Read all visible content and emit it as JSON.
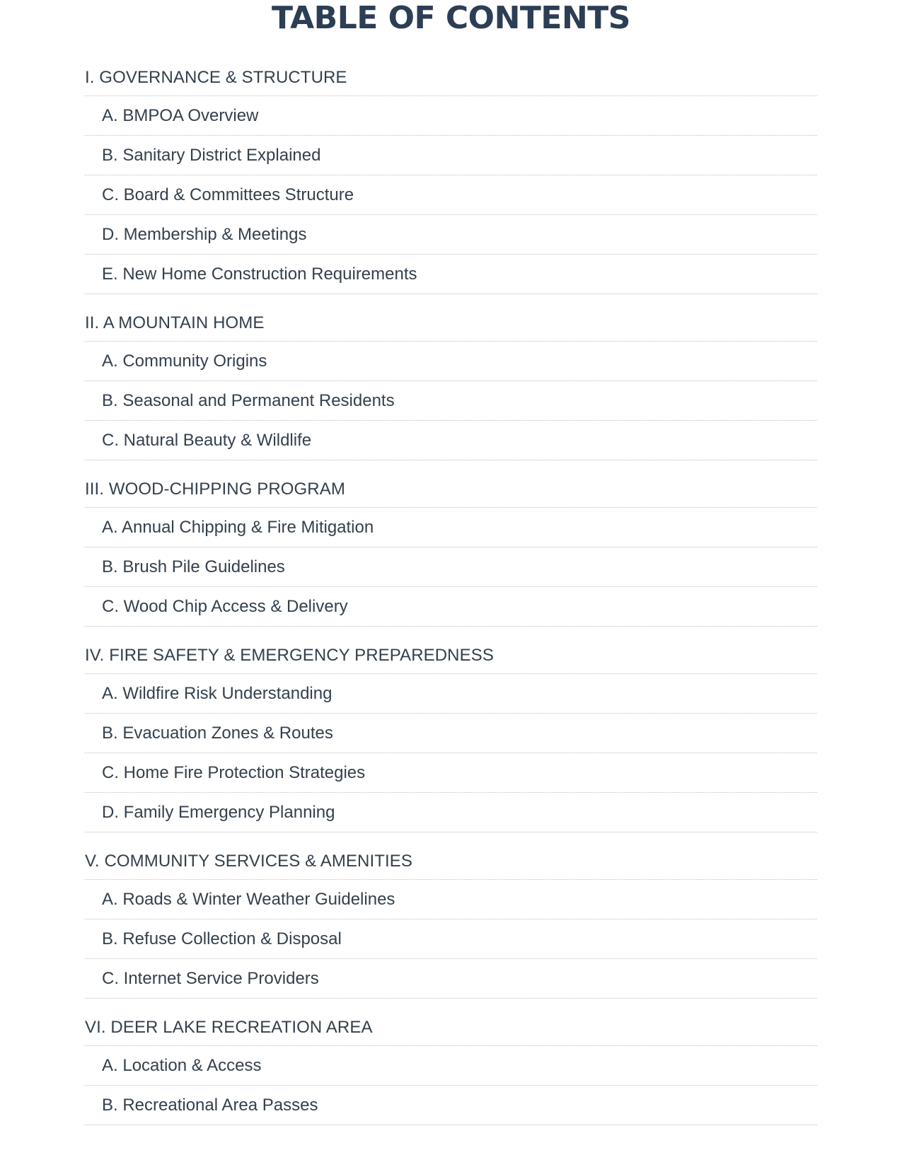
{
  "document": {
    "title": "TABLE OF CONTENTS",
    "sections": [
      {
        "heading": "I. GOVERNANCE & STRUCTURE",
        "items": [
          "A. BMPOA Overview",
          "B. Sanitary District Explained",
          "C. Board & Committees Structure",
          "D. Membership & Meetings",
          "E. New Home Construction Requirements"
        ]
      },
      {
        "heading": "II. A MOUNTAIN HOME",
        "items": [
          "A. Community Origins",
          "B. Seasonal and Permanent Residents",
          "C. Natural Beauty & Wildlife"
        ]
      },
      {
        "heading": "III. WOOD-CHIPPING PROGRAM",
        "items": [
          "A. Annual Chipping & Fire Mitigation",
          "B. Brush Pile Guidelines",
          "C. Wood Chip Access & Delivery"
        ]
      },
      {
        "heading": "IV. FIRE SAFETY & EMERGENCY PREPAREDNESS",
        "items": [
          "A. Wildfire Risk Understanding",
          "B. Evacuation Zones & Routes",
          "C. Home Fire Protection Strategies",
          "D. Family Emergency Planning"
        ]
      },
      {
        "heading": "V. COMMUNITY SERVICES & AMENITIES",
        "items": [
          "A. Roads & Winter Weather Guidelines",
          "B. Refuse Collection & Disposal",
          "C. Internet Service Providers"
        ]
      },
      {
        "heading": "VI. DEER LAKE RECREATION AREA",
        "items": [
          "A. Location & Access",
          "B. Recreational Area Passes"
        ]
      }
    ]
  }
}
